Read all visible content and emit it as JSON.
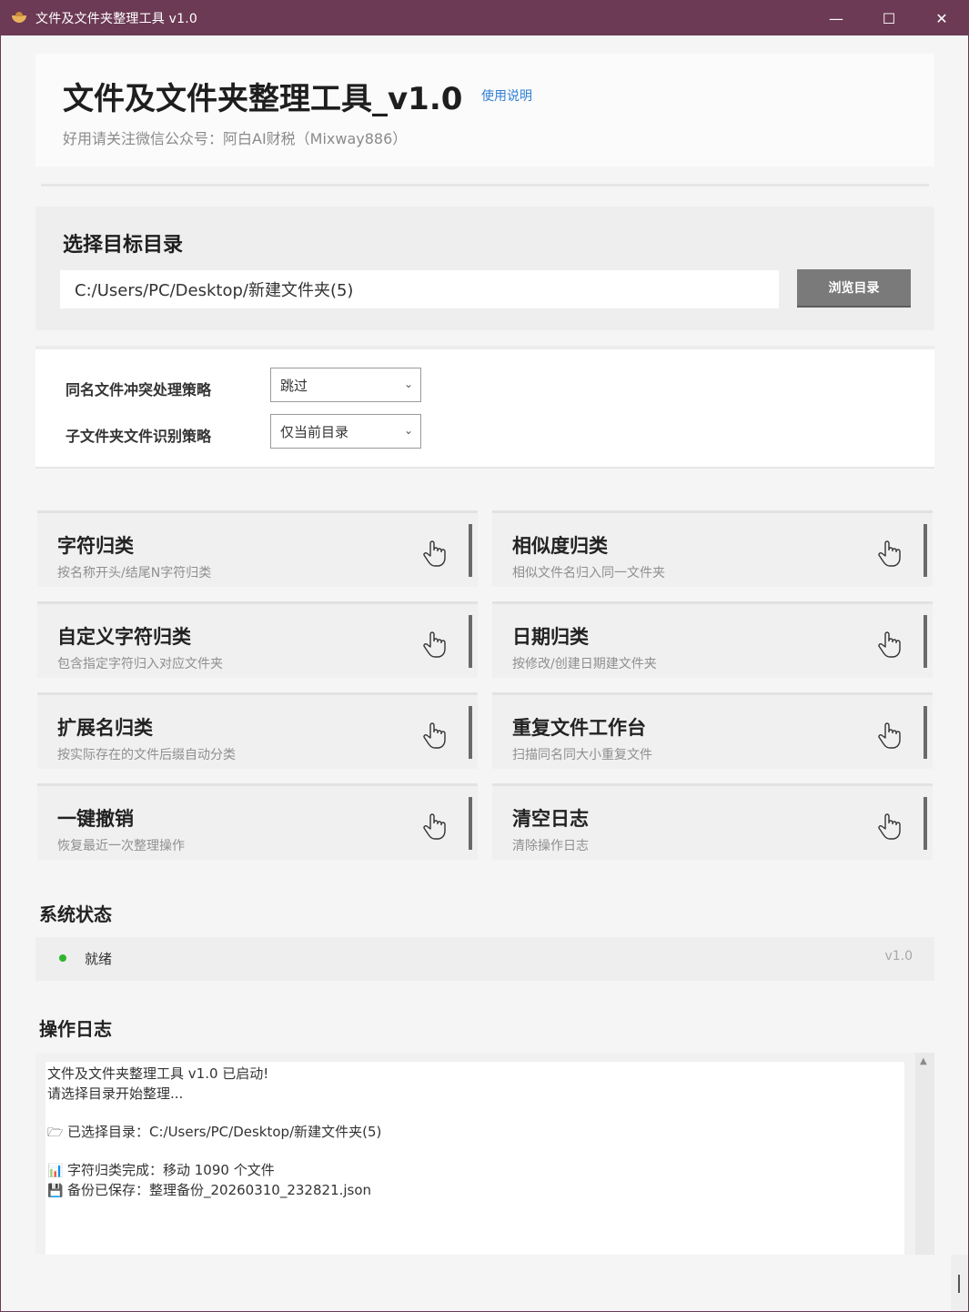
{
  "window": {
    "title": "文件及文件夹整理工具 v1.0",
    "minimize_glyph": "—",
    "maximize_glyph": "☐",
    "close_glyph": "✕"
  },
  "header": {
    "title": "文件及文件夹整理工具_v1.0",
    "help_link": "使用说明",
    "subtitle": "好用请关注微信公众号：阿白AI财税（Mixway886）"
  },
  "directory": {
    "section_title": "选择目标目录",
    "path_value": "C:/Users/PC/Desktop/新建文件夹(5)",
    "browse_button": "浏览目录"
  },
  "options": {
    "conflict_label": "同名文件冲突处理策略",
    "conflict_value": "跳过",
    "subfolder_label": "子文件夹文件识别策略",
    "subfolder_value": "仅当前目录"
  },
  "actions": [
    {
      "title": "字符归类",
      "desc": "按名称开头/结尾N字符归类"
    },
    {
      "title": "相似度归类",
      "desc": "相似文件名归入同一文件夹"
    },
    {
      "title": "自定义字符归类",
      "desc": "包含指定字符归入对应文件夹"
    },
    {
      "title": "日期归类",
      "desc": "按修改/创建日期建文件夹"
    },
    {
      "title": "扩展名归类",
      "desc": "按实际存在的文件后缀自动分类"
    },
    {
      "title": "重复文件工作台",
      "desc": "扫描同名同大小重复文件"
    },
    {
      "title": "一键撤销",
      "desc": "恢复最近一次整理操作"
    },
    {
      "title": "清空日志",
      "desc": "清除操作日志"
    }
  ],
  "status": {
    "section_title": "系统状态",
    "text": "就绪",
    "version": "v1.0",
    "dot_color": "#2fb52f"
  },
  "log": {
    "section_title": "操作日志",
    "lines": [
      {
        "icon": "",
        "text": "文件及文件夹整理工具 v1.0 已启动!"
      },
      {
        "icon": "",
        "text": "请选择目录开始整理..."
      },
      {
        "icon": "🗁",
        "text": "已选择目录：C:/Users/PC/Desktop/新建文件夹(5)"
      },
      {
        "icon": "📊",
        "text": "字符归类完成：移动 1090 个文件"
      },
      {
        "icon": "💾",
        "text": "备份已保存：整理备份_20260310_232821.json"
      }
    ]
  },
  "colors": {
    "titlebar": "#6c3a54",
    "link": "#2f7fd6",
    "button": "#7a7a7a"
  }
}
